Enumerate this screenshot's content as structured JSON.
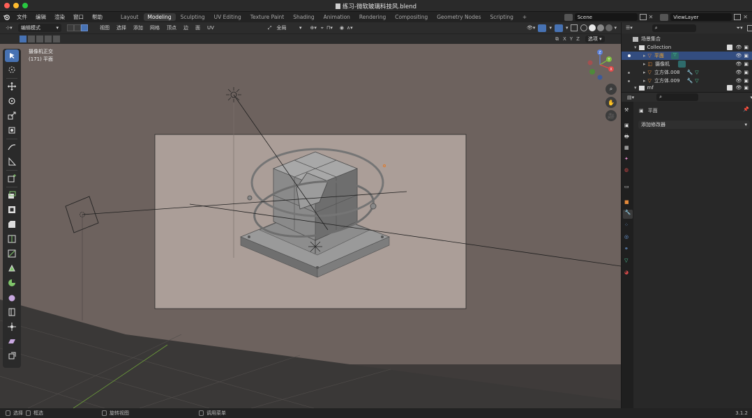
{
  "window": {
    "title": "练习-微软玻璃科技风.blend"
  },
  "menubar": {
    "items": [
      "文件",
      "编辑",
      "渲染",
      "窗口",
      "帮助"
    ],
    "workspaces": [
      "Layout",
      "Modeling",
      "Sculpting",
      "UV Editing",
      "Texture Paint",
      "Shading",
      "Animation",
      "Rendering",
      "Compositing",
      "Geometry Nodes",
      "Scripting"
    ],
    "active_workspace": "Modeling",
    "add_tab": "+",
    "scene": "Scene",
    "view_layer": "ViewLayer"
  },
  "header": {
    "mode": "编辑模式",
    "menus": [
      "视图",
      "选择",
      "添加",
      "网格",
      "顶点",
      "边",
      "面",
      "UV"
    ],
    "transform": "全局"
  },
  "header3": {
    "axes": [
      "X",
      "Y",
      "Z"
    ],
    "options": "选项"
  },
  "viewport": {
    "view_name": "摄像机正交",
    "object_info": "(171) 平面"
  },
  "outliner": {
    "root": "场景集合",
    "collection": "Collection",
    "items": [
      {
        "name": "平面"
      },
      {
        "name": "摄像机"
      },
      {
        "name": "立方体.008"
      },
      {
        "name": "立方体.009"
      }
    ],
    "partial": "mf"
  },
  "properties": {
    "object_name": "平面",
    "add_modifier": "添加修改器"
  },
  "statusbar": {
    "items": [
      "选择",
      "框选",
      "旋转视图",
      "调用菜单"
    ],
    "version": "3.1.2"
  },
  "colors": {
    "accent": "#4772b3",
    "viewport_bg": "#6d625e",
    "camera_frame": "#ab9e98",
    "panel": "#282828"
  }
}
